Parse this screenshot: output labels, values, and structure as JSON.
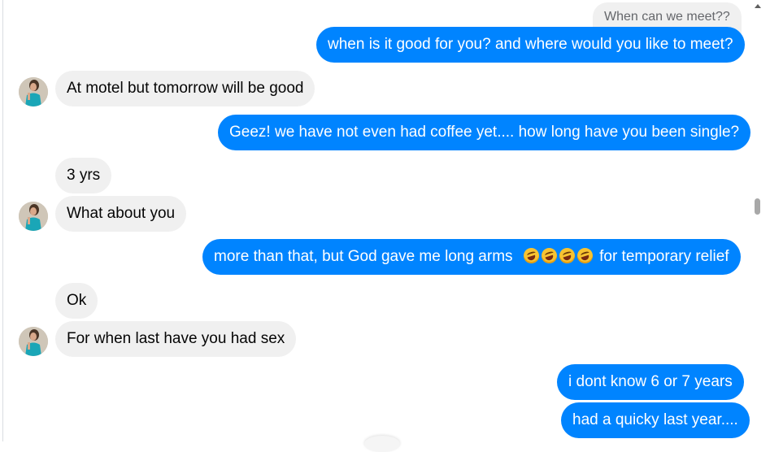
{
  "chat": {
    "quoted_reply": "When  can we meet??",
    "messages": [
      {
        "from": "me",
        "text": "when is it good for you? and where would you like to meet?"
      },
      {
        "from": "them",
        "text": "At motel but tomorrow will be good"
      },
      {
        "from": "me",
        "text": "Geez!  we have not even had coffee yet....  how long have you been single?"
      },
      {
        "from": "them",
        "text": "3 yrs"
      },
      {
        "from": "them",
        "text": "What about you"
      },
      {
        "from": "me",
        "text_before": "more than that,  but God gave me long arms",
        "emoji_count": 4,
        "emoji_name": "rolling-on-floor-laughing-emoji",
        "text_after": "for temporary relief"
      },
      {
        "from": "them",
        "text": "Ok"
      },
      {
        "from": "them",
        "text": "For when last have you had sex"
      },
      {
        "from": "me",
        "text": "i dont know 6 or 7 years"
      },
      {
        "from": "me",
        "text": "had a quicky last year...."
      }
    ]
  },
  "colors": {
    "outgoing_bubble": "#0084ff",
    "incoming_bubble": "#f0f0f0"
  },
  "icons": {
    "avatar": "profile-photo",
    "scroll_up": "scroll-up-arrow-icon"
  }
}
